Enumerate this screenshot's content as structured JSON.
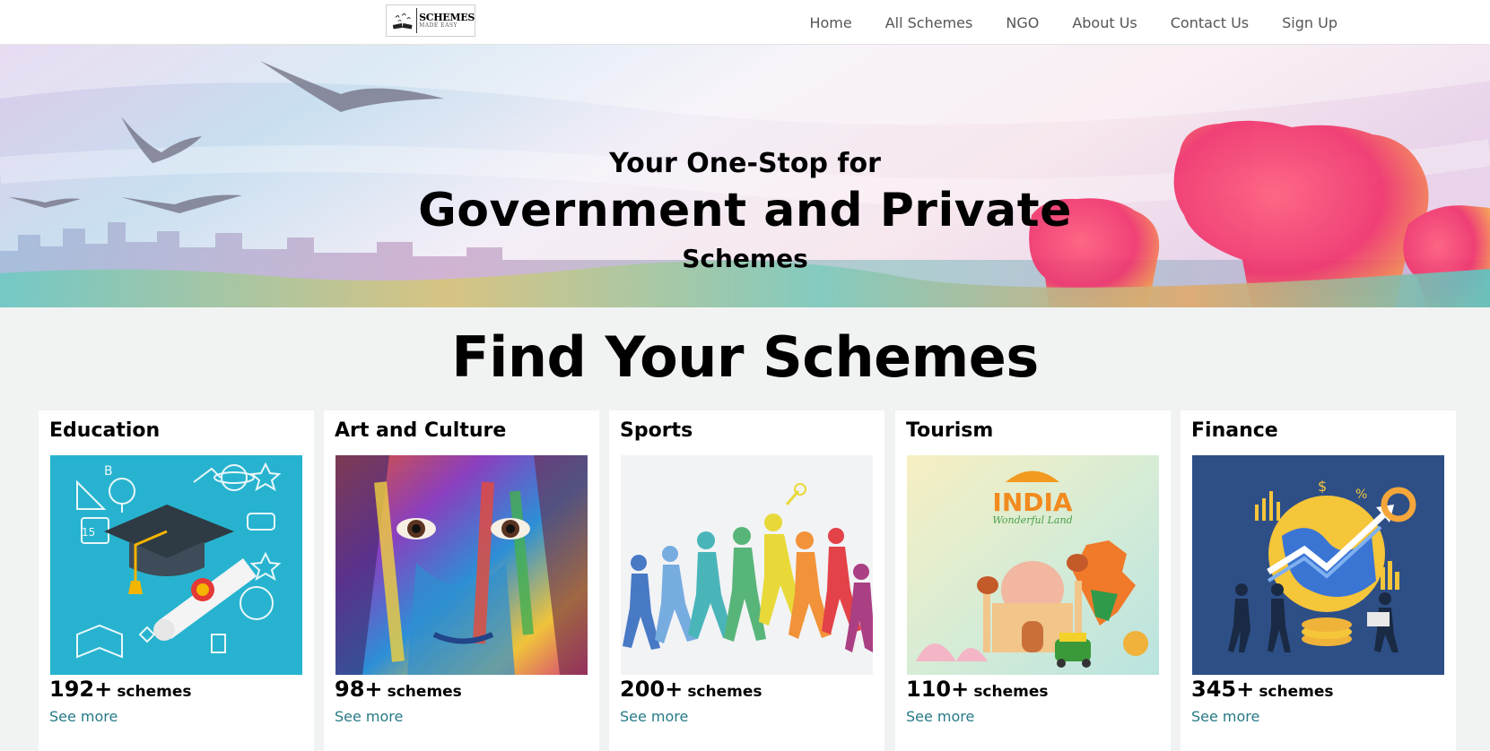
{
  "logo": {
    "title": "SCHEMES",
    "subtitle": "MADE EASY"
  },
  "nav": {
    "items": [
      {
        "label": "Home"
      },
      {
        "label": "All Schemes"
      },
      {
        "label": "NGO"
      },
      {
        "label": "About Us"
      },
      {
        "label": "Contact Us"
      },
      {
        "label": "Sign Up"
      }
    ]
  },
  "hero": {
    "line1": "Your One-Stop for",
    "line2": "Government and Private",
    "line3": "Schemes"
  },
  "section": {
    "title": "Find Your Schemes"
  },
  "categories": [
    {
      "title": "Education",
      "count": "192+",
      "unit": "schemes",
      "link": "See more",
      "image": "education-illustration"
    },
    {
      "title": "Art and Culture",
      "count": "98+",
      "unit": "schemes",
      "link": "See more",
      "image": "painted-face-photo"
    },
    {
      "title": "Sports",
      "count": "200+",
      "unit": "schemes",
      "link": "See more",
      "image": "athletes-silhouettes"
    },
    {
      "title": "Tourism",
      "count": "110+",
      "unit": "schemes",
      "link": "See more",
      "image": "india-wonderful-land"
    },
    {
      "title": "Finance",
      "count": "345+",
      "unit": "schemes",
      "link": "See more",
      "image": "finance-growth-illustration"
    }
  ],
  "colors": {
    "link": "#267a86",
    "page_bg": "#f1f3f2",
    "nav_text": "#555555"
  }
}
